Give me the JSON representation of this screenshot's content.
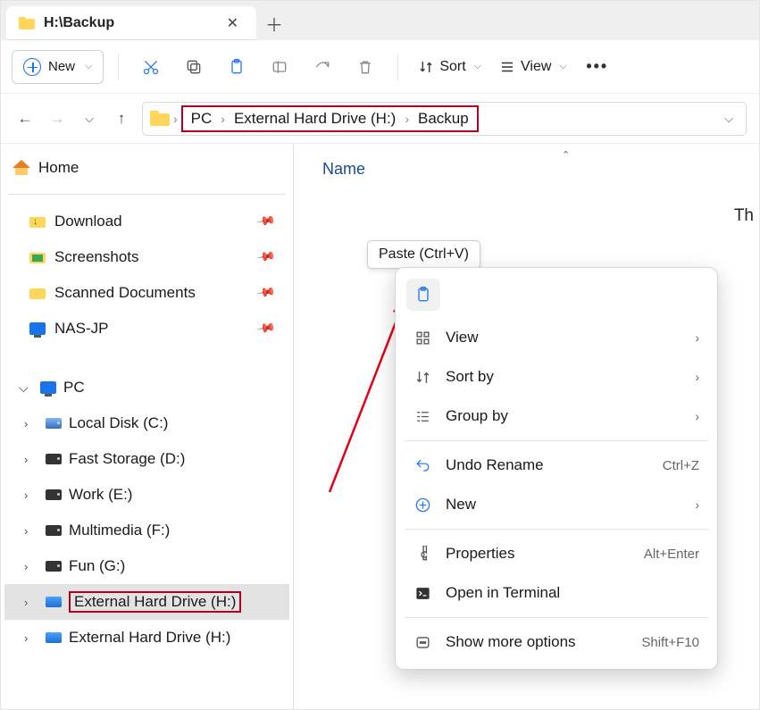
{
  "tab": {
    "title": "H:\\Backup"
  },
  "toolbar": {
    "new_label": "New",
    "sort_label": "Sort",
    "view_label": "View"
  },
  "breadcrumb": {
    "seg1": "PC",
    "seg2": "External Hard Drive (H:)",
    "seg3": "Backup"
  },
  "sidebar": {
    "home": "Home",
    "quick": [
      {
        "label": "Download"
      },
      {
        "label": "Screenshots"
      },
      {
        "label": "Scanned Documents"
      },
      {
        "label": "NAS-JP"
      }
    ],
    "pc": "PC",
    "drives": [
      {
        "label": "Local Disk (C:)"
      },
      {
        "label": "Fast Storage (D:)"
      },
      {
        "label": "Work (E:)"
      },
      {
        "label": "Multimedia (F:)"
      },
      {
        "label": "Fun (G:)"
      },
      {
        "label": "External Hard Drive (H:)"
      },
      {
        "label": "External Hard Drive (H:)"
      }
    ]
  },
  "content": {
    "column_name": "Name",
    "empty_hint_prefix": "Th"
  },
  "tooltip": {
    "paste": "Paste (Ctrl+V)"
  },
  "context_menu": {
    "view": "View",
    "sort_by": "Sort by",
    "group_by": "Group by",
    "undo_rename": "Undo Rename",
    "undo_shortcut": "Ctrl+Z",
    "new": "New",
    "properties": "Properties",
    "properties_shortcut": "Alt+Enter",
    "open_terminal": "Open in Terminal",
    "show_more": "Show more options",
    "show_more_shortcut": "Shift+F10"
  }
}
